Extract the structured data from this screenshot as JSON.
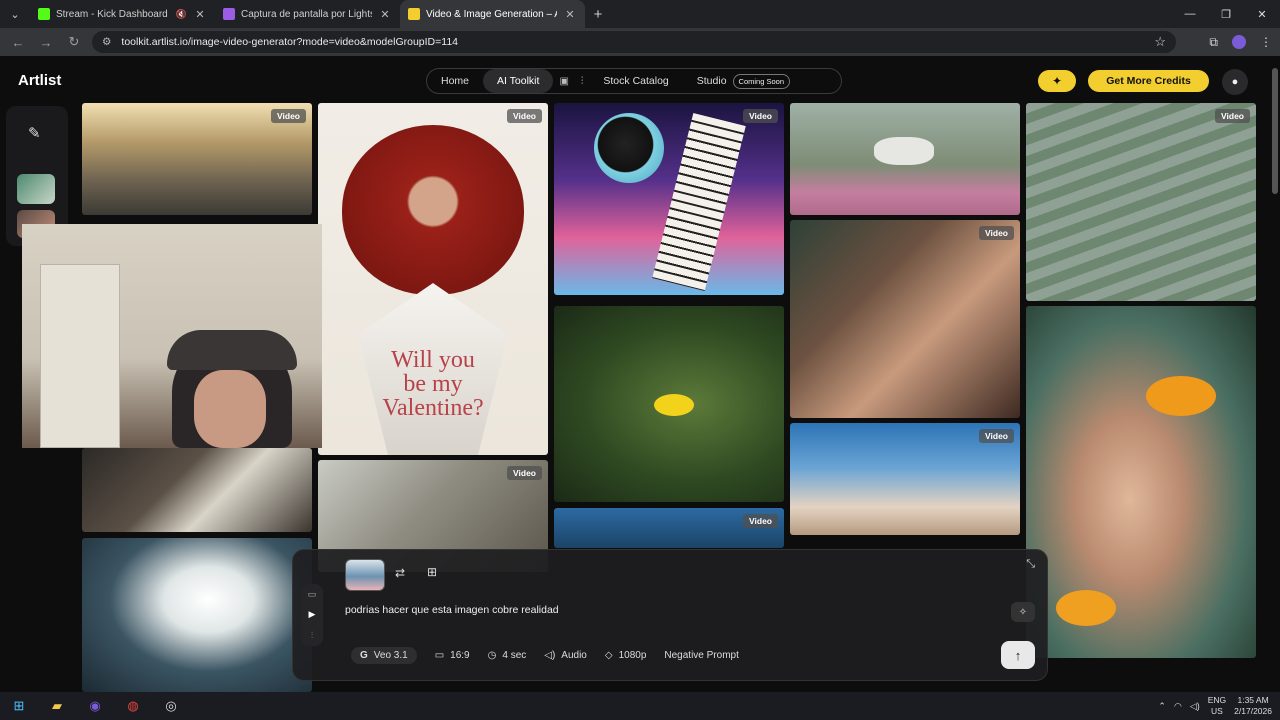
{
  "browser": {
    "tabs": [
      {
        "title": "Stream - Kick Dashboard",
        "favicon_color": "#53fc18"
      },
      {
        "title": "Captura de pantalla por Lightshot",
        "favicon_color": "#9b5de5"
      },
      {
        "title": "Video & Image Generation – AI",
        "favicon_color": "#f2cf2e"
      }
    ],
    "url": "toolkit.artlist.io/image-video-generator?mode=video&modelGroupID=114"
  },
  "header": {
    "logo": "Artlist",
    "nav": {
      "home": "Home",
      "ai_toolkit": "AI Toolkit",
      "stock_catalog": "Stock Catalog",
      "studio": "Studio",
      "coming_soon": "Coming Soon"
    },
    "credits_button": "Get More Credits"
  },
  "gallery": {
    "badge": "Video",
    "valentine_line1": "Will you",
    "valentine_line2": "be my",
    "valentine_line3": "Valentine?"
  },
  "prompt": {
    "text": "podrias hacer que esta imagen cobre realidad",
    "options": {
      "model": "Veo 3.1",
      "aspect": "16:9",
      "duration": "4 sec",
      "audio": "Audio",
      "resolution": "1080p",
      "negative": "Negative Prompt"
    }
  },
  "taskbar": {
    "lang_line1": "ENG",
    "lang_line2": "US",
    "time": "1:35 AM",
    "date": "2/17/2026"
  },
  "colors": {
    "accent": "#f2cf2e",
    "background": "#0d0d0e"
  }
}
